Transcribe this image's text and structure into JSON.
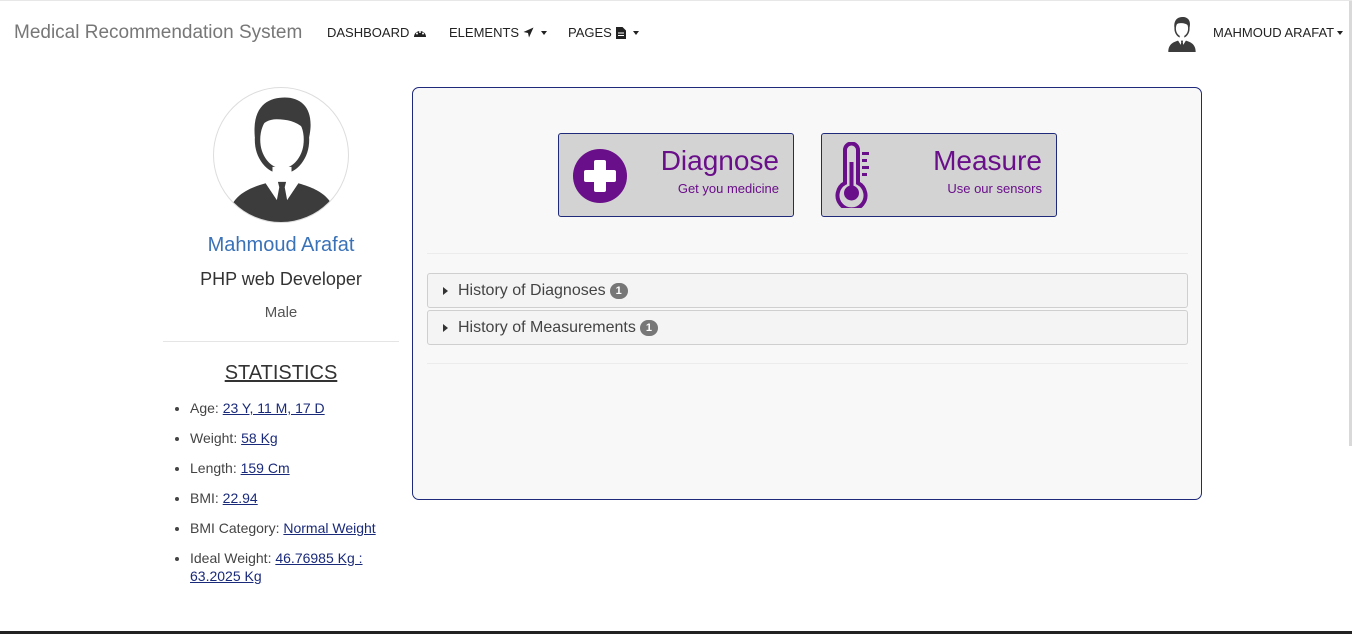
{
  "navbar": {
    "brand": "Medical Recommendation System",
    "items": [
      {
        "label": "DASHBOARD",
        "icon": "dashboard-icon"
      },
      {
        "label": "ELEMENTS",
        "icon": "location-arrow-icon"
      },
      {
        "label": "PAGES",
        "icon": "file-icon"
      }
    ],
    "user_name": "MAHMOUD ARAFAT"
  },
  "profile": {
    "name": "Mahmoud Arafat",
    "role": "PHP web Developer",
    "gender": "Male"
  },
  "statistics": {
    "title": "STATISTICS",
    "items": [
      {
        "label": "Age:",
        "value": "23 Y, 11 M, 17 D"
      },
      {
        "label": "Weight:",
        "value": "58 Kg"
      },
      {
        "label": "Length:",
        "value": "159 Cm"
      },
      {
        "label": "BMI:",
        "value": "22.94"
      },
      {
        "label": "BMI Category:",
        "value": "Normal Weight"
      },
      {
        "label": "Ideal Weight:",
        "value": "46.76985 Kg : 63.2025 Kg"
      }
    ]
  },
  "actions": {
    "diagnose": {
      "title": "Diagnose",
      "subtitle": "Get you medicine",
      "icon": "plus-circle-icon"
    },
    "measure": {
      "title": "Measure",
      "subtitle": "Use our sensors",
      "icon": "thermometer-icon"
    }
  },
  "history": {
    "diagnoses": {
      "label": "History of Diagnoses",
      "count": "1"
    },
    "measurements": {
      "label": "History of Measurements",
      "count": "1"
    }
  },
  "colors": {
    "accent": "#6a0f8a",
    "border": "#1f2a7a",
    "link": "#3a72b8"
  }
}
